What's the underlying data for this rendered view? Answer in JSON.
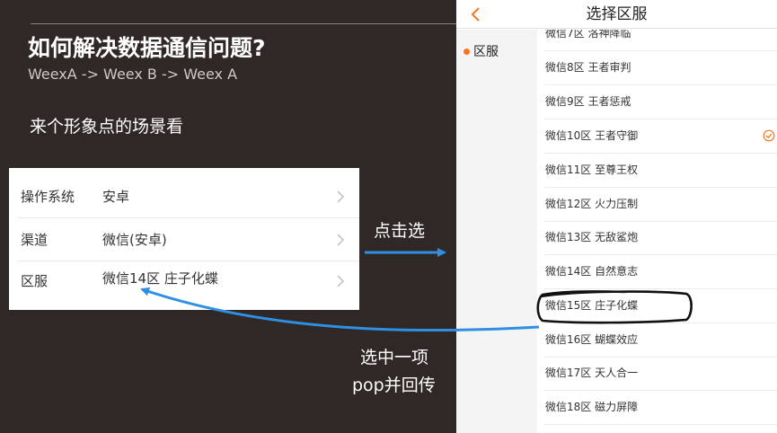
{
  "slide": {
    "title": "如何解决数据通信问题?",
    "subtitle": "WeexA -> Weex B -> Weex A",
    "caption": "来个形象点的场景看"
  },
  "form": {
    "rows": [
      {
        "label": "操作系统",
        "value": "安卓"
      },
      {
        "label": "渠道",
        "value": "微信(安卓)"
      },
      {
        "label": "区服",
        "value": "微信14区 庄子化蝶"
      }
    ]
  },
  "annotations": {
    "tap_select": "点击选",
    "select_one": "选中一项",
    "pop_return": "pop并回传"
  },
  "phone": {
    "back_icon": "chevron-left-icon",
    "title": "选择区服",
    "side_item": "区服",
    "servers": [
      "微信7区 洛神降临",
      "微信8区 王者审判",
      "微信9区 王者惩戒",
      "微信10区 王者守御",
      "微信11区 至尊王权",
      "微信12区 火力压制",
      "微信13区 无敌鲨炮",
      "微信14区 自然意志",
      "微信15区 庄子化蝶",
      "微信16区 蝴蝶效应",
      "微信17区 天人合一",
      "微信18区 磁力屏障"
    ],
    "checked_server": "微信10区 王者守御",
    "highlighted_server": "微信15区 庄子化蝶"
  },
  "colors": {
    "background": "#2f2826",
    "accent_orange": "#f5751f",
    "arrow_blue": "#2f8fe3"
  }
}
